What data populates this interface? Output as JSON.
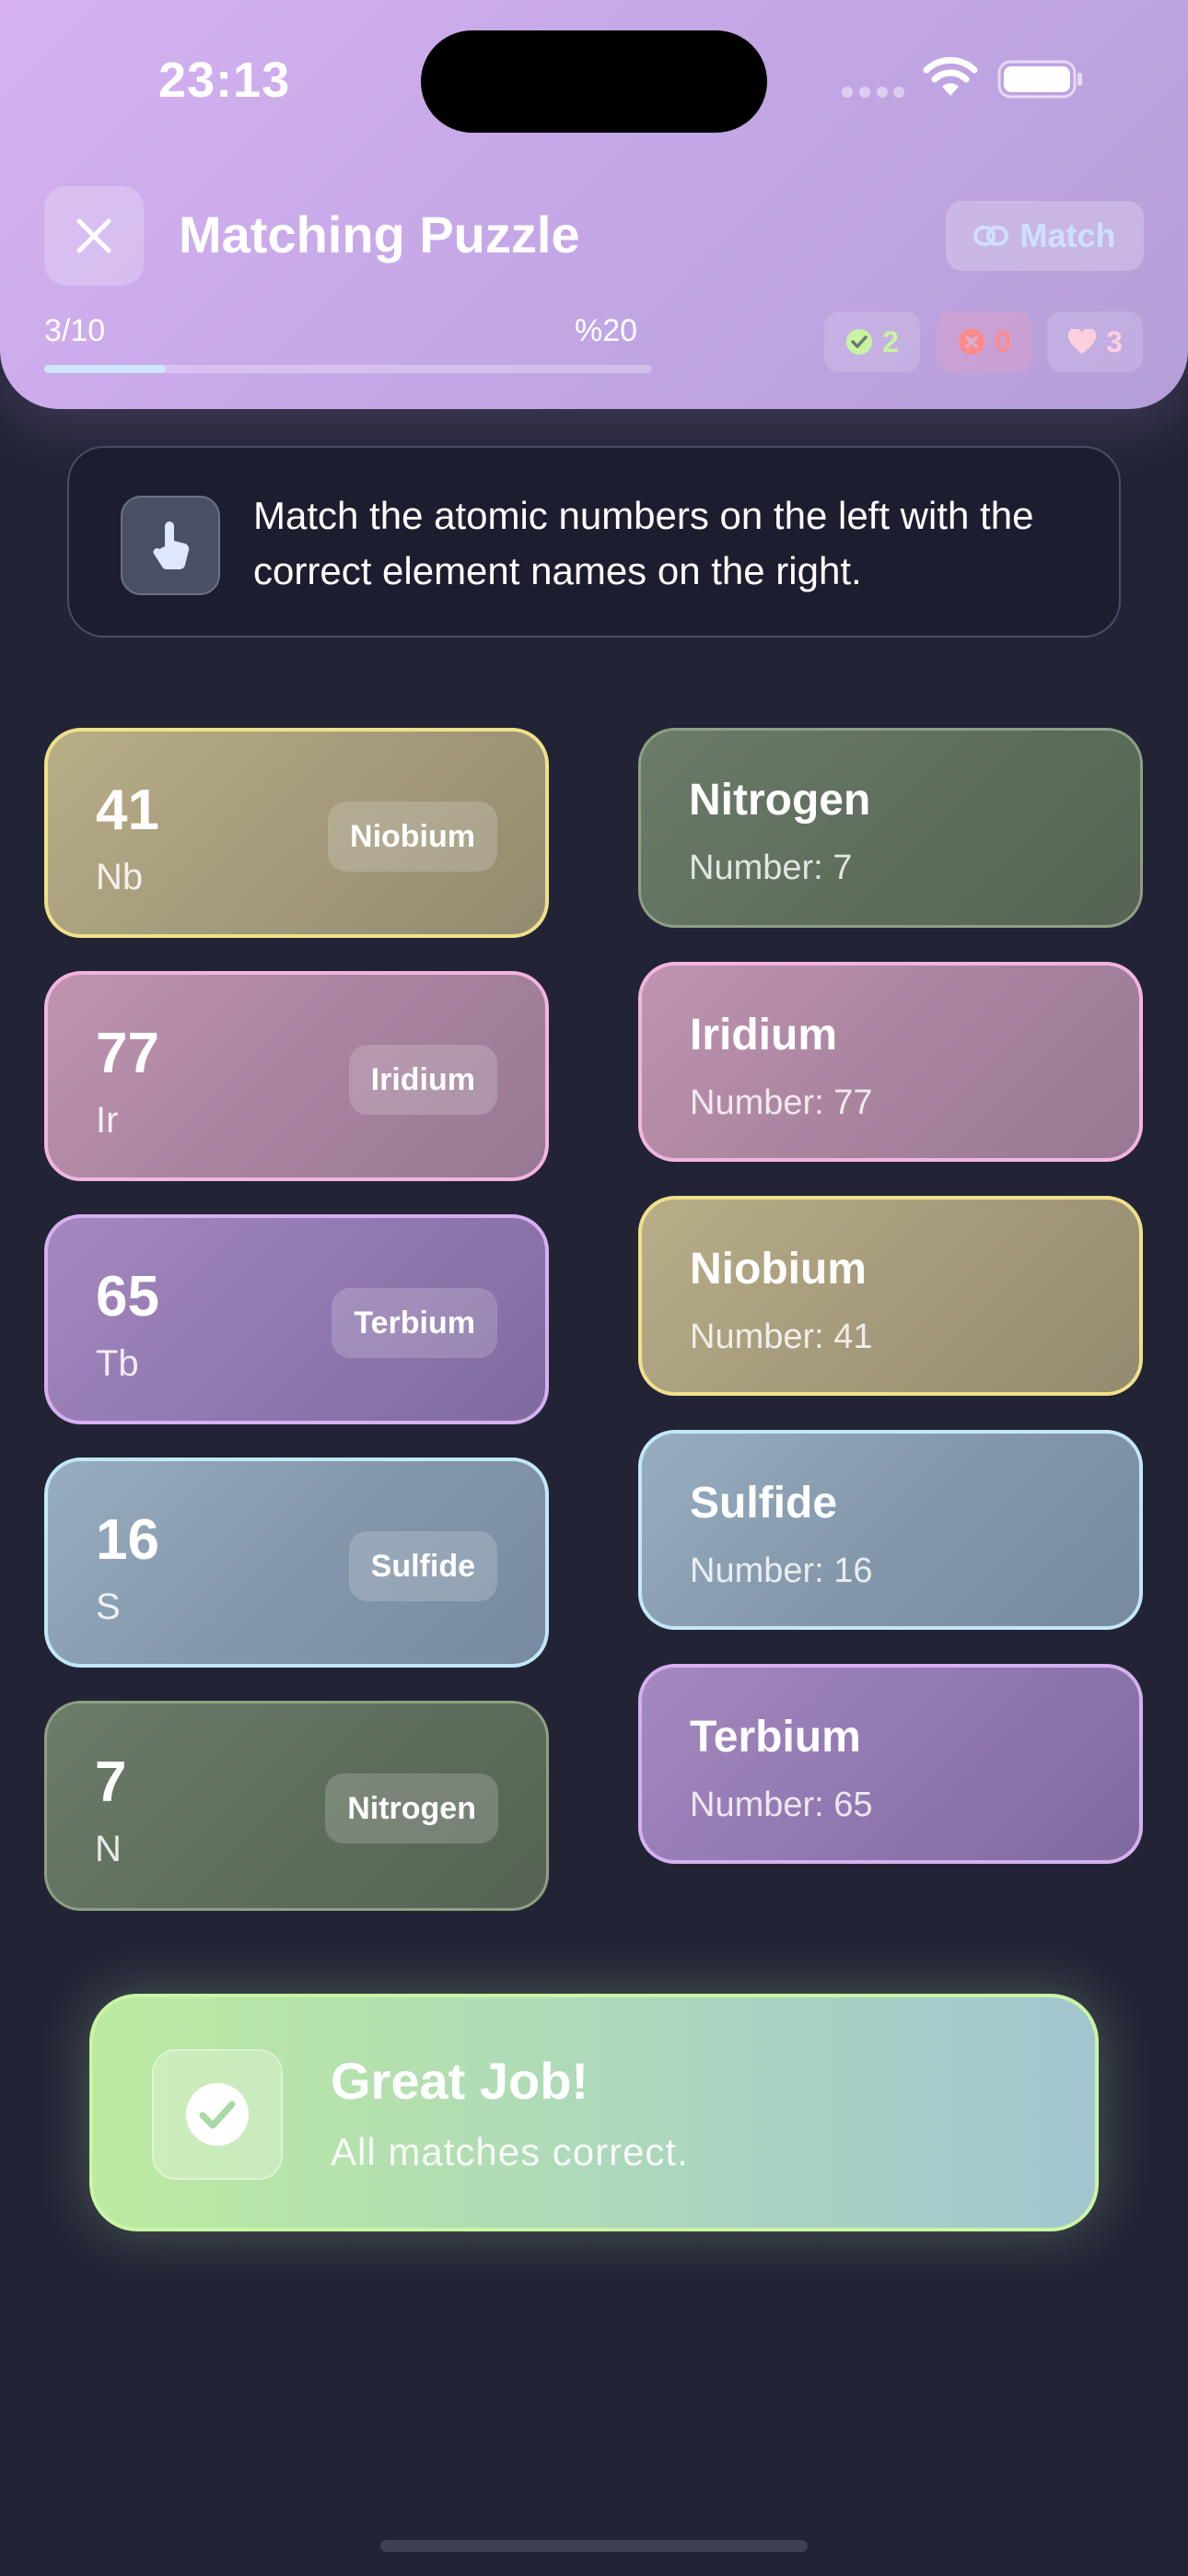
{
  "status_bar": {
    "time": "23:13"
  },
  "header": {
    "title": "Matching Puzzle",
    "match_button_label": "Match",
    "progress_count": "3/10",
    "progress_percent": "%20",
    "progress_fraction": 0.2,
    "stats": {
      "correct": "2",
      "wrong": "0",
      "lives": "3"
    }
  },
  "instruction": {
    "text": "Match the atomic numbers on the left with the correct element names on the right."
  },
  "left_items": [
    {
      "number": "41",
      "symbol": "Nb",
      "match": "Niobium",
      "color": "#efe18a"
    },
    {
      "number": "77",
      "symbol": "Ir",
      "match": "Iridium",
      "color": "#f2b4e0"
    },
    {
      "number": "65",
      "symbol": "Tb",
      "match": "Terbium",
      "color": "#d6b0f0"
    },
    {
      "number": "16",
      "symbol": "S",
      "match": "Sulfide",
      "color": "#c2e8f8"
    },
    {
      "number": "7",
      "symbol": "N",
      "match": "Nitrogen",
      "color": "#8ea083"
    }
  ],
  "right_items": [
    {
      "name": "Nitrogen",
      "number_text": "Number: 7"
    },
    {
      "name": "Iridium",
      "number_text": "Number: 77"
    },
    {
      "name": "Niobium",
      "number_text": "Number: 41"
    },
    {
      "name": "Sulfide",
      "number_text": "Number: 16"
    },
    {
      "name": "Terbium",
      "number_text": "Number: 65"
    }
  ],
  "result": {
    "title": "Great Job!",
    "subtitle": "All matches correct."
  }
}
